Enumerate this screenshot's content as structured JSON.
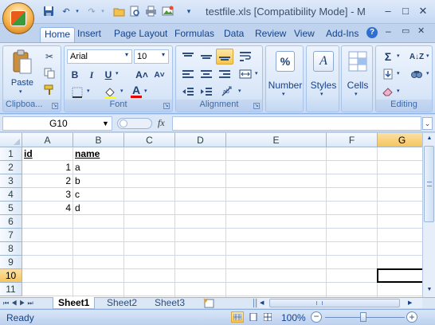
{
  "window": {
    "title": "testfile.xls  [Compatibility Mode] - M",
    "minimize_glyph": "–",
    "restore_glyph": "□",
    "close_glyph": "✕"
  },
  "ribbon_tabs": [
    "Home",
    "Insert",
    "Page Layout",
    "Formulas",
    "Data",
    "Review",
    "View",
    "Add-Ins"
  ],
  "ribbon": {
    "clipboard": {
      "label": "Clipboa...",
      "paste": "Paste"
    },
    "font": {
      "label": "Font",
      "name": "Arial",
      "size": "10",
      "bold": "B",
      "italic": "I",
      "underline": "U",
      "grow": "A˄",
      "shrink": "A˅",
      "fontcolor": "A"
    },
    "alignment": {
      "label": "Alignment"
    },
    "number": {
      "label": "Number",
      "symbol": "%"
    },
    "styles": {
      "label": "Styles",
      "symbol": "A"
    },
    "cells": {
      "label": "Cells"
    },
    "editing": {
      "label": "Editing",
      "sum": "Σ",
      "sort": "A↓Z"
    }
  },
  "formula_bar": {
    "name_box": "G10",
    "fx": "fx",
    "value": ""
  },
  "sheet": {
    "columns": [
      "A",
      "B",
      "C",
      "D",
      "E",
      "F",
      "G"
    ],
    "selected_column": "G",
    "rows": [
      "1",
      "2",
      "3",
      "4",
      "5",
      "6",
      "7",
      "8",
      "9",
      "10",
      "11"
    ],
    "selected_row": "10",
    "active_cell": "G10",
    "cells": [
      {
        "row": 1,
        "col": "A",
        "value": "id",
        "bold": true,
        "underline": true,
        "align": "left"
      },
      {
        "row": 1,
        "col": "B",
        "value": "name",
        "bold": true,
        "underline": true,
        "align": "left"
      },
      {
        "row": 2,
        "col": "A",
        "value": "1",
        "align": "right"
      },
      {
        "row": 2,
        "col": "B",
        "value": "a",
        "align": "left"
      },
      {
        "row": 3,
        "col": "A",
        "value": "2",
        "align": "right"
      },
      {
        "row": 3,
        "col": "B",
        "value": "b",
        "align": "left"
      },
      {
        "row": 4,
        "col": "A",
        "value": "3",
        "align": "right"
      },
      {
        "row": 4,
        "col": "B",
        "value": "c",
        "align": "left"
      },
      {
        "row": 5,
        "col": "A",
        "value": "4",
        "align": "right"
      },
      {
        "row": 5,
        "col": "B",
        "value": "d",
        "align": "left"
      }
    ]
  },
  "sheet_tabs": [
    "Sheet1",
    "Sheet2",
    "Sheet3"
  ],
  "active_sheet": "Sheet1",
  "status": {
    "mode": "Ready",
    "zoom": "100%"
  }
}
